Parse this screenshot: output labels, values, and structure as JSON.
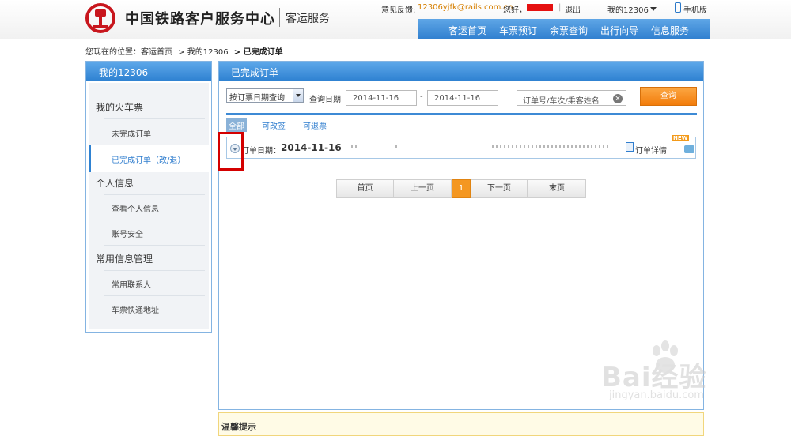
{
  "header": {
    "logo_text": "中国铁路客户服务中心",
    "logo_sub": "客运服务",
    "feedback_label": "意见反馈:",
    "feedback_email": "12306yjfk@rails.com.cn",
    "hello_label": "您好，",
    "logout": "退出",
    "my12306": "我的12306",
    "mobile": "手机版"
  },
  "nav": {
    "items": [
      "客运首页",
      "车票预订",
      "余票查询",
      "出行向导",
      "信息服务"
    ]
  },
  "breadcrumb": {
    "prefix": "您现在的位置：客运首页",
    "sep1": "> 我的12306",
    "current": "> 已完成订单"
  },
  "sidebar": {
    "title": "我的12306",
    "sections": [
      {
        "label": "我的火车票",
        "items": [
          "未完成订单",
          "已完成订单（改/退）"
        ]
      },
      {
        "label": "个人信息",
        "items": [
          "查看个人信息",
          "账号安全"
        ]
      },
      {
        "label": "常用信息管理",
        "items": [
          "常用联系人",
          "车票快递地址"
        ]
      }
    ]
  },
  "panel": {
    "title": "已完成订单",
    "query_type": "按订票日期查询",
    "date_label": "查询日期",
    "date_from": "2014-11-16",
    "date_to": "2014-11-16",
    "date_dash": "-",
    "search_placeholder": "订单号/车次/乘客姓名",
    "query_button": "查询",
    "filters": [
      "全部",
      "可改签",
      "可退票"
    ],
    "order": {
      "date_label": "订单日期：",
      "date_value": "2014-11-16",
      "detail_link": "订单详情",
      "new_badge": "NEW"
    },
    "pager": [
      "首页",
      "上一页",
      "1",
      "下一页",
      "末页"
    ]
  },
  "tip": {
    "title": "温馨提示"
  },
  "watermark": {
    "text": "Bai经验",
    "url": "jingyan.baidu.com"
  },
  "colors": {
    "primary_blue": "#2f82d2",
    "accent_orange": "#f27c0b",
    "highlight_red": "#d40000"
  }
}
